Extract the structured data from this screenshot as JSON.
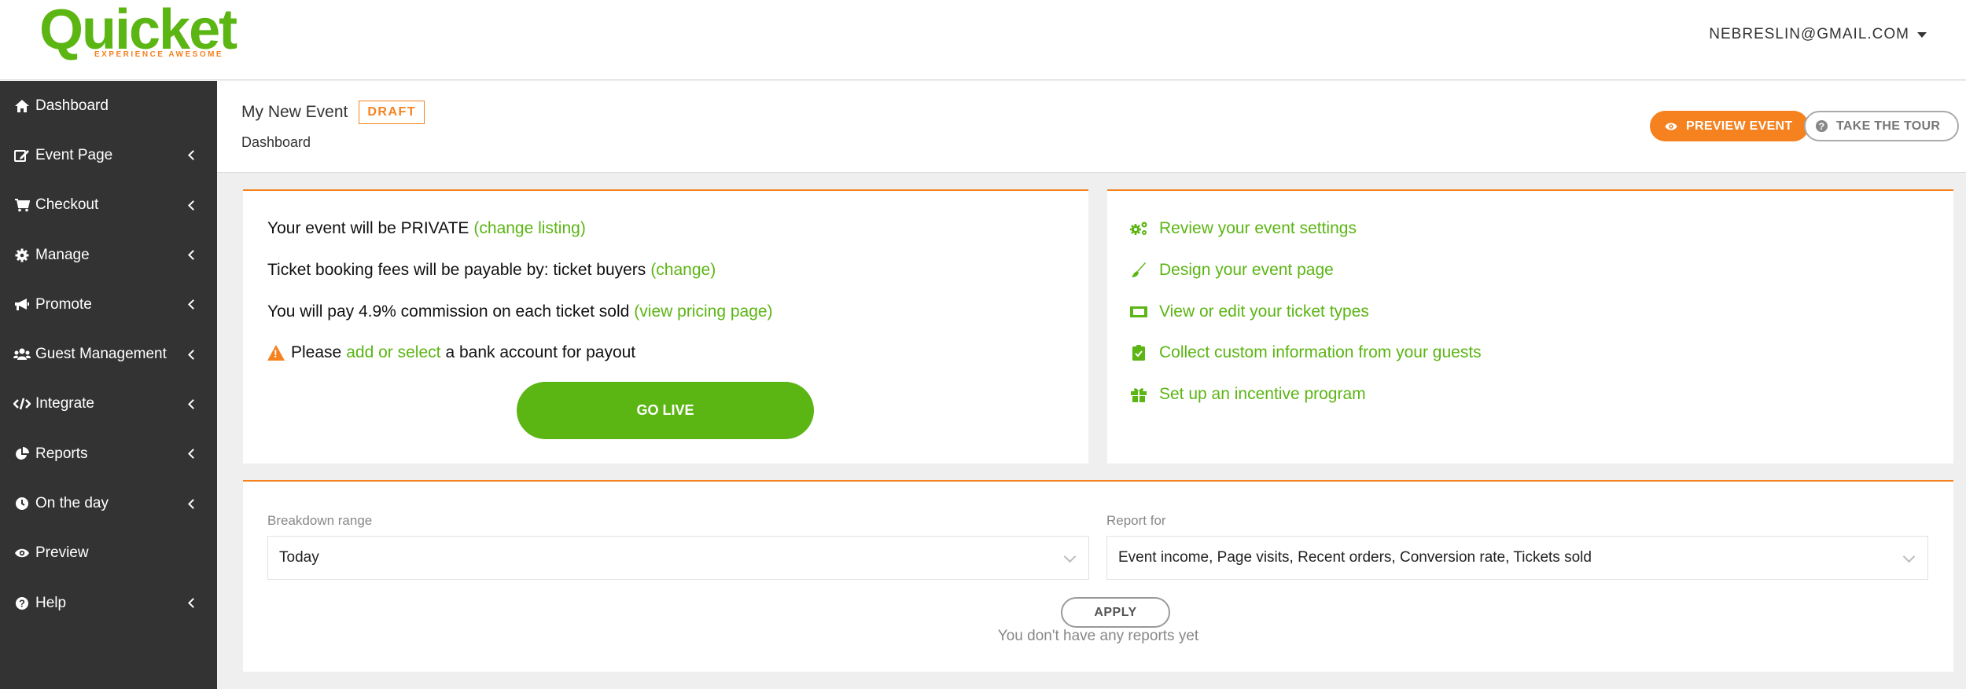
{
  "brand": {
    "name": "Quicket",
    "tagline": "EXPERIENCE AWESOME",
    "green": "#5bb513",
    "orange": "#f5821f"
  },
  "user": {
    "email": "NEBRESLIN@GMAIL.COM"
  },
  "sidebar": {
    "items": [
      {
        "label": "Dashboard",
        "icon": "home-icon",
        "has_submenu": false
      },
      {
        "label": "Event Page",
        "icon": "edit-icon",
        "has_submenu": true
      },
      {
        "label": "Checkout",
        "icon": "cart-icon",
        "has_submenu": true
      },
      {
        "label": "Manage",
        "icon": "gear-icon",
        "has_submenu": true
      },
      {
        "label": "Promote",
        "icon": "megaphone-icon",
        "has_submenu": true
      },
      {
        "label": "Guest Management",
        "icon": "users-icon",
        "has_submenu": true
      },
      {
        "label": "Integrate",
        "icon": "code-icon",
        "has_submenu": true
      },
      {
        "label": "Reports",
        "icon": "pie-chart-icon",
        "has_submenu": true
      },
      {
        "label": "On the day",
        "icon": "clock-icon",
        "has_submenu": true
      },
      {
        "label": "Preview",
        "icon": "eye-icon",
        "has_submenu": false
      },
      {
        "label": "Help",
        "icon": "question-icon",
        "has_submenu": true
      }
    ]
  },
  "header": {
    "event_name": "My New Event",
    "status_badge": "DRAFT",
    "breadcrumb": "Dashboard",
    "preview_button": "PREVIEW EVENT",
    "tour_button": "TAKE THE TOUR"
  },
  "status_card": {
    "listing": {
      "text": "Your event will be PRIVATE",
      "link": "(change listing)"
    },
    "fees": {
      "text": "Ticket booking fees will be payable by: ticket buyers",
      "link": "(change)"
    },
    "commission": {
      "text": "You will pay 4.9% commission on each ticket sold",
      "link": "(view pricing page)"
    },
    "bank": {
      "before": "Please",
      "link": "add or select",
      "after": "a bank account for payout"
    },
    "go_live_button": "GO LIVE"
  },
  "actions_card": {
    "items": [
      {
        "label": "Review your event settings",
        "icon": "gears-icon"
      },
      {
        "label": "Design your event page",
        "icon": "paintbrush-icon"
      },
      {
        "label": "View or edit your ticket types",
        "icon": "ticket-icon"
      },
      {
        "label": "Collect custom information from your guests",
        "icon": "clipboard-check-icon"
      },
      {
        "label": "Set up an incentive program",
        "icon": "gift-icon"
      }
    ]
  },
  "reports_card": {
    "breakdown_label": "Breakdown range",
    "breakdown_value": "Today",
    "report_for_label": "Report for",
    "report_for_value": "Event income, Page visits, Recent orders, Conversion rate, Tickets sold",
    "apply_button": "APPLY",
    "empty_message": "You don't have any reports yet"
  }
}
